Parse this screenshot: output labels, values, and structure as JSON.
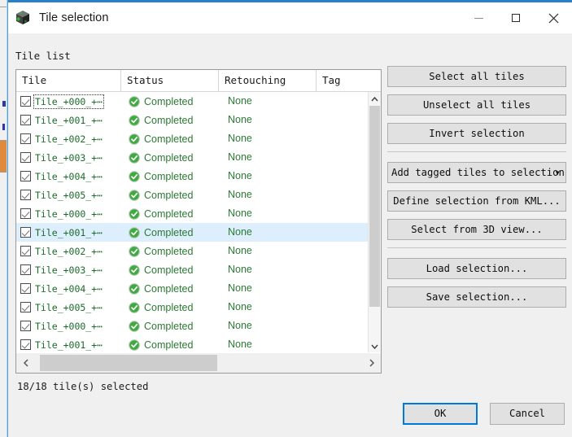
{
  "window": {
    "title": "Tile selection",
    "icon": "cube-icon",
    "controls": {
      "minimize": "minimize-icon",
      "maximize": "maximize-icon",
      "close": "close-icon"
    },
    "accent_color": "#2a7fc9"
  },
  "group": {
    "label": "Tile list"
  },
  "table": {
    "columns": [
      "Tile",
      "Status",
      "Retouching",
      "Tag"
    ],
    "rows": [
      {
        "tile": "Tile_+000_+⋯",
        "checked": true,
        "status": "Completed",
        "retouching": "None",
        "tag": "",
        "selected": false,
        "focused": true
      },
      {
        "tile": "Tile_+001_+⋯",
        "checked": true,
        "status": "Completed",
        "retouching": "None",
        "tag": "",
        "selected": false,
        "focused": false
      },
      {
        "tile": "Tile_+002_+⋯",
        "checked": true,
        "status": "Completed",
        "retouching": "None",
        "tag": "",
        "selected": false,
        "focused": false
      },
      {
        "tile": "Tile_+003_+⋯",
        "checked": true,
        "status": "Completed",
        "retouching": "None",
        "tag": "",
        "selected": false,
        "focused": false
      },
      {
        "tile": "Tile_+004_+⋯",
        "checked": true,
        "status": "Completed",
        "retouching": "None",
        "tag": "",
        "selected": false,
        "focused": false
      },
      {
        "tile": "Tile_+005_+⋯",
        "checked": true,
        "status": "Completed",
        "retouching": "None",
        "tag": "",
        "selected": false,
        "focused": false
      },
      {
        "tile": "Tile_+000_+⋯",
        "checked": true,
        "status": "Completed",
        "retouching": "None",
        "tag": "",
        "selected": false,
        "focused": false
      },
      {
        "tile": "Tile_+001_+⋯",
        "checked": true,
        "status": "Completed",
        "retouching": "None",
        "tag": "",
        "selected": true,
        "focused": false
      },
      {
        "tile": "Tile_+002_+⋯",
        "checked": true,
        "status": "Completed",
        "retouching": "None",
        "tag": "",
        "selected": false,
        "focused": false
      },
      {
        "tile": "Tile_+003_+⋯",
        "checked": true,
        "status": "Completed",
        "retouching": "None",
        "tag": "",
        "selected": false,
        "focused": false
      },
      {
        "tile": "Tile_+004_+⋯",
        "checked": true,
        "status": "Completed",
        "retouching": "None",
        "tag": "",
        "selected": false,
        "focused": false
      },
      {
        "tile": "Tile_+005_+⋯",
        "checked": true,
        "status": "Completed",
        "retouching": "None",
        "tag": "",
        "selected": false,
        "focused": false
      },
      {
        "tile": "Tile_+000_+⋯",
        "checked": true,
        "status": "Completed",
        "retouching": "None",
        "tag": "",
        "selected": false,
        "focused": false
      },
      {
        "tile": "Tile_+001_+⋯",
        "checked": true,
        "status": "Completed",
        "retouching": "None",
        "tag": "",
        "selected": false,
        "focused": false
      }
    ],
    "status_icon": "completed-check-icon",
    "status_color": "#2b7a33",
    "tile_text_color": "#1a6b2a",
    "selected_row_color": "#ddeefc"
  },
  "scrollbars": {
    "vertical": {
      "up_icon": "chevron-up-icon",
      "down_icon": "chevron-down-icon"
    },
    "horizontal": {
      "left_icon": "chevron-left-icon",
      "right_icon": "chevron-right-icon"
    }
  },
  "side_buttons": [
    {
      "label": "Select all tiles",
      "name": "select-all-tiles-button",
      "type": "button"
    },
    {
      "label": "Unselect all tiles",
      "name": "unselect-all-tiles-button",
      "type": "button"
    },
    {
      "label": "Invert selection",
      "name": "invert-selection-button",
      "type": "button"
    },
    {
      "label": "Add tagged tiles to selection",
      "name": "add-tagged-tiles-dropdown",
      "type": "dropdown",
      "caret": "▾"
    },
    {
      "label": "Define selection from KML...",
      "name": "define-selection-from-kml-button",
      "type": "button"
    },
    {
      "label": "Select from 3D view...",
      "name": "select-from-3d-view-button",
      "type": "button"
    },
    {
      "label": "Load selection...",
      "name": "load-selection-button",
      "type": "button"
    },
    {
      "label": "Save selection...",
      "name": "save-selection-button",
      "type": "button"
    }
  ],
  "status_line": "18/18 tile(s) selected",
  "footer": {
    "ok": "OK",
    "cancel": "Cancel",
    "focus_color": "#0078d7"
  }
}
